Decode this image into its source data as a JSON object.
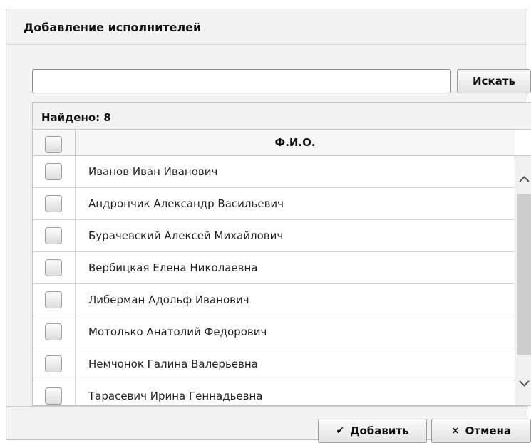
{
  "dialog": {
    "title": "Добавление исполнителей",
    "search": {
      "value": "",
      "placeholder": "",
      "button_label": "Искать"
    },
    "grid": {
      "found_text": "Найдено: 8",
      "column_header": "Ф.И.О.",
      "rows": [
        "Иванов Иван Иванович",
        "Андрончик Александр Васильевич",
        "Бурачевский Алексей Михайлович",
        "Вербицкая Елена Николаевна",
        "Либерман Адольф Иванович",
        "Мотолько Анатолий Федорович",
        "Немчонок Галина Валерьевна",
        "Тарасевич Ирина Геннадьевна"
      ]
    },
    "footer": {
      "add_label": "Добавить",
      "add_icon": "✔",
      "cancel_label": "Отмена",
      "cancel_icon": "×"
    }
  },
  "colors": {
    "dialog_bg": "#f2f2f2",
    "border": "#bdbdbd",
    "scroll_thumb": "#cdcdcd"
  },
  "icons": {
    "scroll_up": "chevron-up-icon",
    "scroll_down": "chevron-down-icon",
    "add": "check-icon",
    "cancel": "close-icon"
  }
}
